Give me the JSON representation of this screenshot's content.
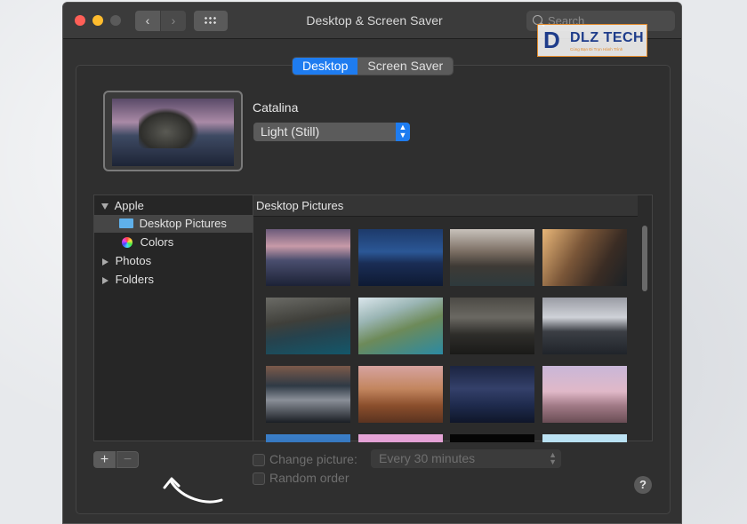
{
  "window": {
    "title": "Desktop & Screen Saver",
    "search_placeholder": "Search"
  },
  "watermark": {
    "letter": "D",
    "text": "DLZ TECH",
    "tagline": "Cùng Bạn Đi Trọn Hành Trình"
  },
  "tabs": [
    {
      "label": "Desktop",
      "active": true
    },
    {
      "label": "Screen Saver",
      "active": false
    }
  ],
  "current_wallpaper": {
    "name": "Catalina",
    "mode": "Light (Still)"
  },
  "sidebar": {
    "items": [
      {
        "label": "Apple",
        "type": "group",
        "expanded": true
      },
      {
        "label": "Desktop Pictures",
        "type": "folder",
        "selected": true
      },
      {
        "label": "Colors",
        "type": "colors"
      },
      {
        "label": "Photos",
        "type": "group",
        "expanded": false
      },
      {
        "label": "Folders",
        "type": "group",
        "expanded": false
      }
    ]
  },
  "gallery": {
    "header": "Desktop Pictures",
    "thumbnails": [
      {
        "name": "catalina-light"
      },
      {
        "name": "catalina-dark"
      },
      {
        "name": "catalina-coast"
      },
      {
        "name": "catalina-sunset-cliff"
      },
      {
        "name": "rock-layers"
      },
      {
        "name": "catalina-shore"
      },
      {
        "name": "stormy-sea"
      },
      {
        "name": "island-clouds"
      },
      {
        "name": "island-fog"
      },
      {
        "name": "mojave-day"
      },
      {
        "name": "mojave-night"
      },
      {
        "name": "desert-rock-pink"
      },
      {
        "name": "blue-gradient"
      },
      {
        "name": "pink-gradient"
      },
      {
        "name": "black"
      },
      {
        "name": "sky-blue"
      }
    ]
  },
  "bottom": {
    "add_label": "+",
    "remove_label": "−",
    "change_picture_label": "Change picture:",
    "interval": "Every 30 minutes",
    "random_order_label": "Random order",
    "help_label": "?"
  },
  "colors": {
    "accent": "#1e7cf0",
    "close": "#ff5f57",
    "minimize": "#febc2e",
    "window_bg": "#323232"
  }
}
